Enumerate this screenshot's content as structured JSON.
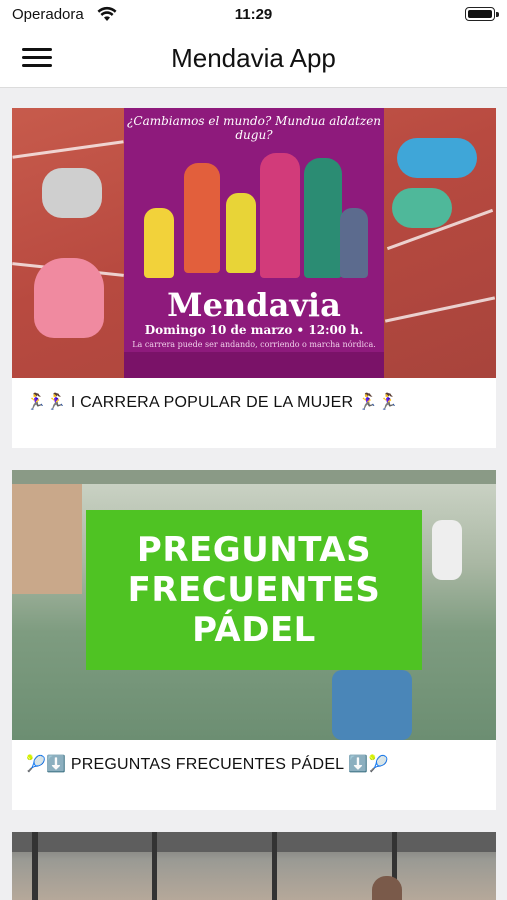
{
  "status_bar": {
    "carrier": "Operadora",
    "time": "11:29"
  },
  "nav": {
    "title": "Mendavia App",
    "menu_icon": "hamburger-menu-icon"
  },
  "posts": [
    {
      "caption": "🏃‍♀️🏃‍♀️ I CARRERA POPULAR DE LA MUJER 🏃‍♀️🏃‍♀️",
      "poster": {
        "subtitle": "¿Cambiamos el mundo? Mundua aldatzen dugu?",
        "title": "Mendavia",
        "date": "Domingo 10 de marzo • 12:00 h.",
        "note": "La carrera puede ser andando, corriendo o marcha nórdica."
      }
    },
    {
      "caption": "🎾⬇️ PREGUNTAS FRECUENTES PÁDEL ⬇️🎾",
      "banner": [
        "PREGUNTAS",
        "FRECUENTES",
        "PÁDEL"
      ]
    },
    {
      "caption": ""
    }
  ],
  "colors": {
    "poster": "#8e1a7c",
    "banner": "#4fc323",
    "background": "#efeff1"
  }
}
